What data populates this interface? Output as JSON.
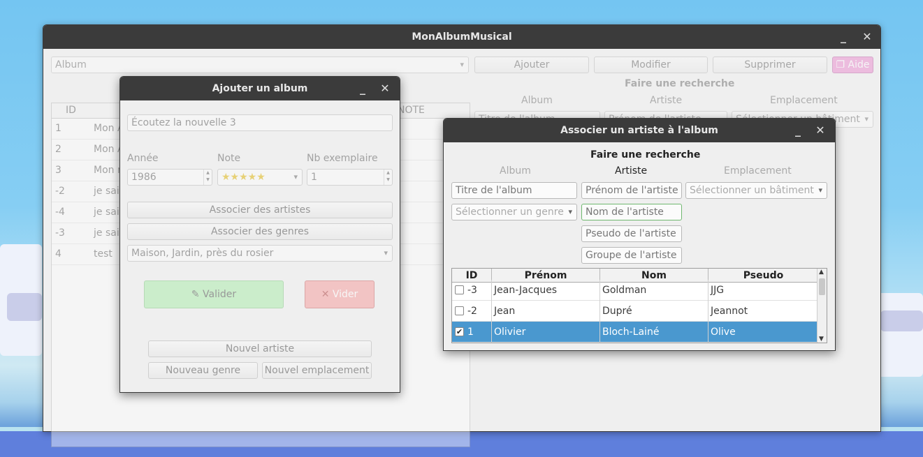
{
  "main": {
    "title": "MonAlbumMusical",
    "album_combo": "Album",
    "buttons": {
      "add": "Ajouter",
      "edit": "Modifier",
      "delete": "Supprimer",
      "help": "Aide"
    },
    "search_title": "Faire une recherche",
    "search_cols": [
      "Album",
      "Artiste",
      "Emplacement"
    ],
    "search_inputs": {
      "album_title": "Titre de l'album",
      "artist_first": "Prénom de l'artiste",
      "building": "Sélectionner un bâtiment"
    },
    "table": {
      "headers": [
        "ID",
        "NOTE"
      ],
      "rows": [
        {
          "id": "1",
          "name": "Mon A"
        },
        {
          "id": "2",
          "name": "Mon A"
        },
        {
          "id": "3",
          "name": "Mon n"
        },
        {
          "id": "-2",
          "name": "je sais"
        },
        {
          "id": "-4",
          "name": "je sais"
        },
        {
          "id": "-3",
          "name": "je sais"
        },
        {
          "id": "4",
          "name": "test"
        }
      ]
    }
  },
  "add_dialog": {
    "title": "Ajouter un album",
    "album_name": "Écoutez la nouvelle 3",
    "labels": {
      "year": "Année",
      "rating": "Note",
      "copies": "Nb exemplaire"
    },
    "year": "1986",
    "rating_stars": "★★★★★",
    "copies": "1",
    "assoc_artists": "Associer des artistes",
    "assoc_genres": "Associer des genres",
    "location": "Maison, Jardin, près du rosier",
    "validate": "Valider",
    "clear": "Vider",
    "new_artist": "Nouvel artiste",
    "new_genre": "Nouveau genre",
    "new_location": "Nouvel emplacement"
  },
  "assoc_dialog": {
    "title": "Associer un artiste à l'album",
    "search_title": "Faire une recherche",
    "cols": {
      "album": "Album",
      "artist": "Artiste",
      "location": "Emplacement"
    },
    "placeholders": {
      "album_title": "Titre de l'album",
      "genre": "Sélectionner un genre",
      "building": "Sélectionner un bâtiment",
      "first_name": "Prénom de l'artiste",
      "last_name": "Nom de l'artiste",
      "nickname": "Pseudo de l'artiste",
      "group": "Groupe de l'artiste"
    },
    "table": {
      "headers": [
        "ID",
        "Prénom",
        "Nom",
        "Pseudo"
      ],
      "rows": [
        {
          "checked": false,
          "id": "-3",
          "first": "Jean-Jacques",
          "last": "Goldman",
          "nick": "JJG"
        },
        {
          "checked": false,
          "id": "-2",
          "first": "Jean",
          "last": "Dupré",
          "nick": "Jeannot"
        },
        {
          "checked": true,
          "id": "1",
          "first": "Olivier",
          "last": "Bloch-Lainé",
          "nick": "Olive"
        }
      ]
    }
  },
  "colors": {
    "validate": "#a8eda8",
    "clear": "#f59a9a",
    "help": "#e977c9",
    "selection": "#4a98cf",
    "titlebar": "#3b3b3b"
  }
}
